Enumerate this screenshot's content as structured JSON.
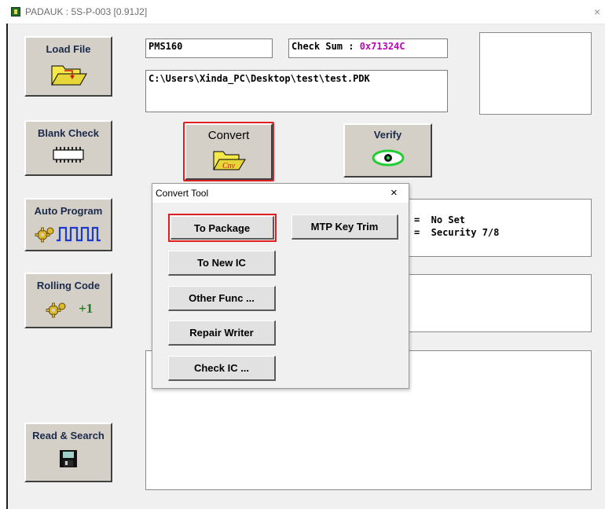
{
  "window": {
    "title": "PADAUK : 5S-P-003 [0.91J2]",
    "close_glyph": "×"
  },
  "buttons": {
    "load_file": "Load File",
    "blank_check": "Blank Check",
    "auto_program": "Auto Program",
    "rolling_code": "Rolling Code",
    "rolling_code_increment": "+1",
    "read_search": "Read & Search",
    "convert": "Convert",
    "convert_icon_text": "Cnv",
    "verify": "Verify"
  },
  "fields": {
    "ic_name": "PMS160",
    "checksum_label": "Check Sum : ",
    "checksum_value": "0x71324C",
    "file_path": "C:\\Users\\Xinda_PC\\Desktop\\test\\test.PDK"
  },
  "info_panel": {
    "lines": [
      "=  No Set",
      "=  Security 7/8"
    ]
  },
  "dialog": {
    "title": "Convert Tool",
    "close_glyph": "×",
    "buttons": {
      "to_package": "To Package",
      "mtp_key_trim": "MTP Key Trim",
      "to_new_ic": "To New IC",
      "other_func": "Other Func ...",
      "repair_writer": "Repair Writer",
      "check_ic": "Check IC ..."
    }
  },
  "colors": {
    "highlight_red": "#e02020",
    "checksum_value": "#c000c0",
    "button_label": "#1b2a4a",
    "folder_yellow": "#f5e84a",
    "verify_green": "#22cc33"
  }
}
